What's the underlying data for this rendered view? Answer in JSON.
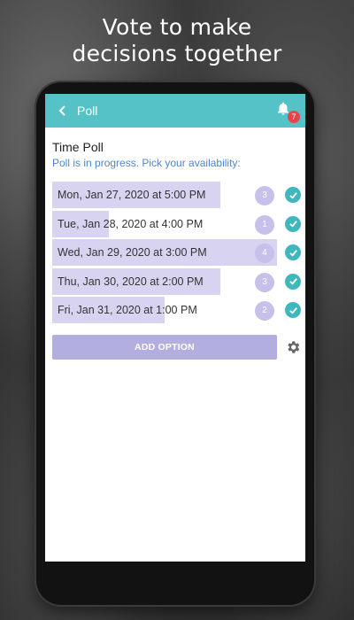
{
  "headline": {
    "line1": "Vote to make",
    "line2": "decisions together"
  },
  "appbar": {
    "title": "Poll",
    "back_icon": "chevron-left-icon",
    "bell_icon": "bell-icon",
    "notification_count": "7"
  },
  "poll": {
    "title": "Time Poll",
    "status": "Poll is in progress. Pick your availability:",
    "options": [
      {
        "label": "Mon, Jan 27, 2020 at 5:00 PM",
        "votes": "3",
        "checked": true
      },
      {
        "label": "Tue, Jan 28, 2020 at 4:00 PM",
        "votes": "1",
        "checked": true
      },
      {
        "label": "Wed, Jan 29, 2020 at 3:00 PM",
        "votes": "4",
        "checked": true
      },
      {
        "label": "Thu, Jan 30, 2020 at 2:00 PM",
        "votes": "3",
        "checked": true
      },
      {
        "label": "Fri, Jan 31, 2020 at 1:00 PM",
        "votes": "2",
        "checked": true
      }
    ],
    "add_option_label": "ADD OPTION",
    "settings_icon": "gear-icon"
  },
  "colors": {
    "appbar": "#54c2c6",
    "option_bar": "#d8d3f0",
    "vote_circle": "#c6c0ea",
    "check": "#40b6bd",
    "add_button": "#b3aee0",
    "badge": "#e8434b",
    "status_text": "#4f86c6"
  }
}
